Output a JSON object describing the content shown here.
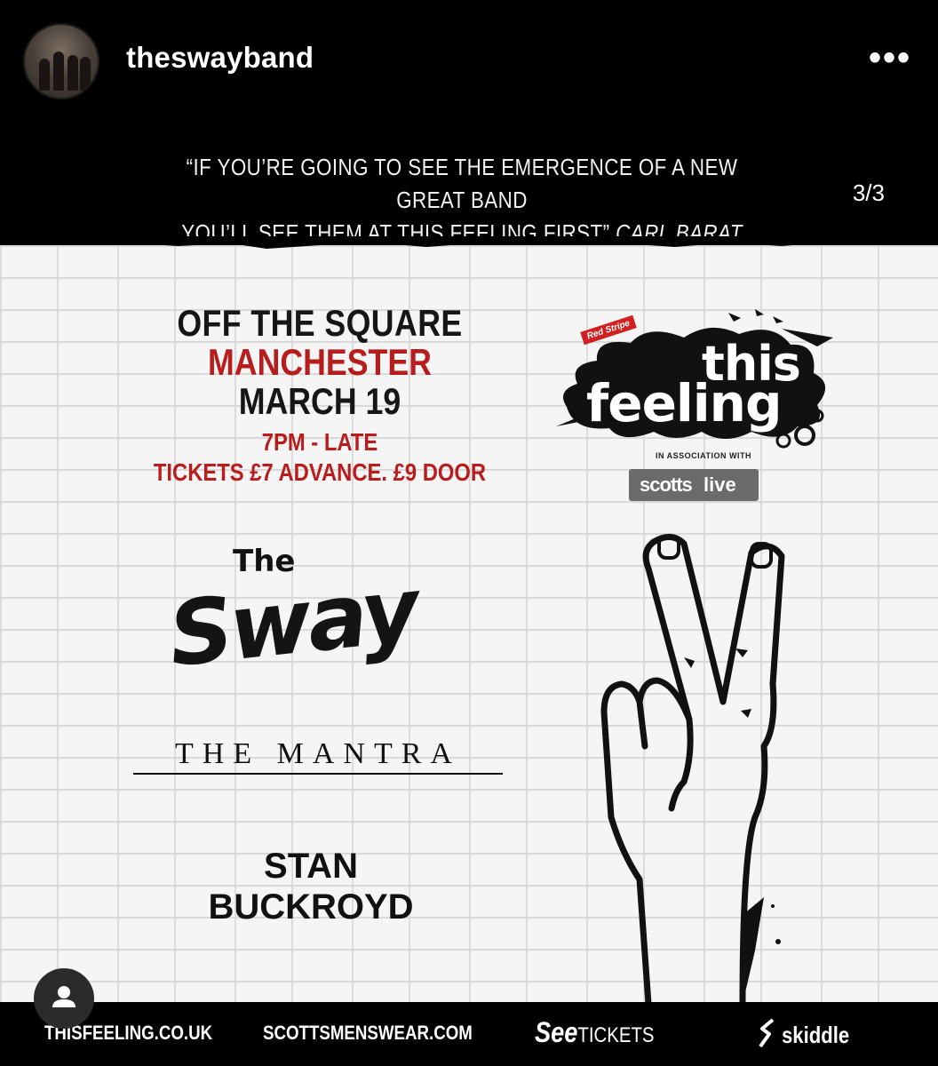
{
  "header": {
    "username": "theswayband",
    "more_icon": "more-horizontal-icon"
  },
  "post": {
    "quote_line1": "“IF YOU’RE GOING TO SEE THE EMERGENCE OF A NEW GREAT BAND",
    "quote_line2": "YOU’LL SEE THEM AT THIS FEELING FIRST”",
    "quote_author": "CARL BARAT",
    "counter": "3/3",
    "event": {
      "venue": "OFF THE SQUARE",
      "city": "MANCHESTER",
      "date": "MARCH 19",
      "time": "7PM - LATE",
      "tickets": "TICKETS £7 ADVANCE. £9 DOOR"
    },
    "logo": {
      "brand_small": "Red Stripe",
      "this": "this",
      "feeling": "feeling",
      "assoc": "IN ASSOCIATION WITH",
      "scotts": "scotts",
      "live": "live"
    },
    "bands": {
      "the": "The",
      "sway": "Sway",
      "mantra": "THE MANTRA",
      "stan": "STAN",
      "buckroyd": "BUCKROYD"
    },
    "footer": {
      "thisfeeling": "THISFEELING.CO.UK",
      "scottsmenswear": "SCOTTSMENSWEAR.COM",
      "see": "See",
      "tickets": "TICKETS",
      "skiddle": "skiddle"
    }
  }
}
